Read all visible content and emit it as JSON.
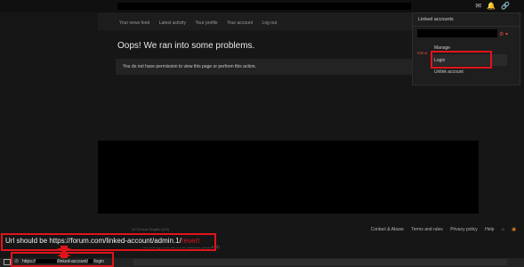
{
  "nav": {
    "items": [
      "Your news feed",
      "Latest activity",
      "Your profile",
      "Your account",
      "Log out"
    ]
  },
  "top_icons": [
    "✉",
    "🔔",
    "🔗"
  ],
  "error": {
    "title": "Oops! We ran into some problems.",
    "message": "You do not have permission to view this page or perform this action."
  },
  "dropdown": {
    "title": "Linked accounts",
    "gear": "⚙ ▾",
    "side_label": "Mana",
    "items": [
      "Manage",
      "Login",
      "Unlink account"
    ]
  },
  "footer": {
    "left_text": "UI.X3 look   English (US)",
    "links": [
      "Contact & Abuse",
      "Terms and rules",
      "Privacy policy",
      "Help"
    ],
    "home_icon": "⌂",
    "rss_icon": "▣"
  },
  "served_by": "Served by: WO-01-1742-5d80fbf (a43be73)",
  "annotation": {
    "prefix": "Url should be https://forum.com/linked-account/admin.1/",
    "highlight": "revert"
  },
  "urlbar": {
    "lock_icon": "⊘",
    "url_start": "https://",
    "url_mid": "/linked-account/",
    "url_end": "/login"
  },
  "colors": {
    "highlight_red": "#e0141b",
    "background": "#161616"
  }
}
